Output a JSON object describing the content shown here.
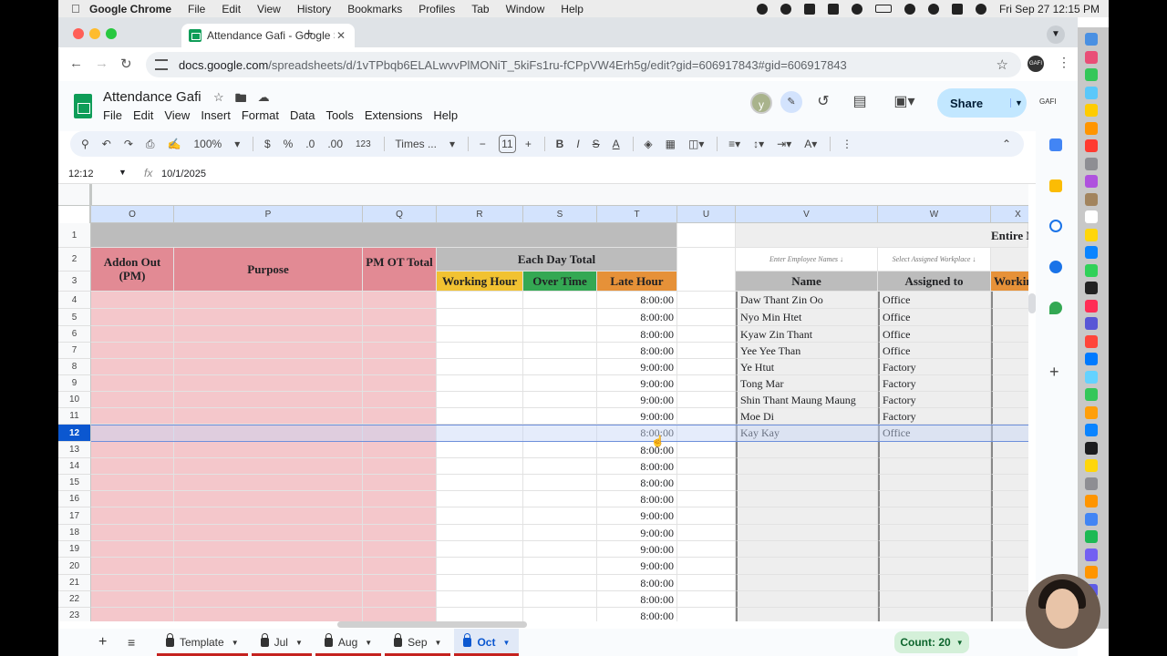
{
  "menubar": {
    "app": "Google Chrome",
    "items": [
      "File",
      "Edit",
      "View",
      "History",
      "Bookmarks",
      "Profiles",
      "Tab",
      "Window",
      "Help"
    ],
    "clock": "Fri Sep 27  12:15 PM"
  },
  "browser": {
    "tab_title": "Attendance Gafi - Google She",
    "url_host": "docs.google.com",
    "url_path": "/spreadsheets/d/1vTPbqb6ELALwvvPlMONiT_5kiFs1ru-fCPpVW4Erh5g/edit?gid=606917843#gid=606917843",
    "profile_label": "GAFI"
  },
  "doc": {
    "title": "Attendance Gafi",
    "menu": [
      "File",
      "Edit",
      "View",
      "Insert",
      "Format",
      "Data",
      "Tools",
      "Extensions",
      "Help"
    ],
    "avatar_initial": "y",
    "share_label": "Share",
    "brand": "GAFI"
  },
  "toolbar": {
    "zoom": "100%",
    "currency": "$",
    "percent": "%",
    "dec_down": ".0",
    "dec_up": ".00",
    "format_123": "123",
    "font": "Times ...",
    "font_size": "11"
  },
  "formula": {
    "namebox": "12:12",
    "fx": "fx",
    "value": "10/1/2025"
  },
  "grid": {
    "columns": [
      "O",
      "P",
      "Q",
      "R",
      "S",
      "T",
      "U",
      "V",
      "W",
      "X"
    ],
    "headers": {
      "addon_out": "Addon Out (PM)",
      "purpose": "Purpose",
      "pm_ot_total": "PM OT Total",
      "each_day_total": "Each Day Total",
      "working_hour": "Working Hour",
      "over_time": "Over Time",
      "late_hour": "Late Hour",
      "entire": "Entire M",
      "enter_names_hint": "Enter Employee Names ↓",
      "select_workplace_hint": "Select Assigned Workplace ↓",
      "name": "Name",
      "assigned_to": "Assigned to",
      "workin": "Workin"
    },
    "row_numbers": [
      "1",
      "2",
      "3",
      "4",
      "5",
      "6",
      "7",
      "8",
      "9",
      "10",
      "11",
      "12",
      "13",
      "14",
      "15",
      "16",
      "17",
      "18",
      "19",
      "20",
      "21",
      "22",
      "23"
    ],
    "selected_row": "12",
    "late_hours": [
      "8:00:00",
      "8:00:00",
      "8:00:00",
      "8:00:00",
      "9:00:00",
      "9:00:00",
      "9:00:00",
      "9:00:00",
      "8:00:00",
      "8:00:00",
      "8:00:00",
      "8:00:00",
      "8:00:00",
      "9:00:00",
      "9:00:00",
      "9:00:00",
      "9:00:00",
      "8:00:00",
      "8:00:00",
      "8:00:00"
    ],
    "employees": [
      {
        "name": "Daw Thant Zin Oo",
        "assigned": "Office"
      },
      {
        "name": "Nyo Min Htet",
        "assigned": "Office"
      },
      {
        "name": "Kyaw Zin Thant",
        "assigned": "Office"
      },
      {
        "name": "Yee Yee Than",
        "assigned": "Office"
      },
      {
        "name": "Ye Htut",
        "assigned": "Factory"
      },
      {
        "name": "Tong Mar",
        "assigned": "Factory"
      },
      {
        "name": "Shin Thant Maung Maung",
        "assigned": "Factory"
      },
      {
        "name": "Moe Di",
        "assigned": "Factory"
      },
      {
        "name": "Kay Kay",
        "assigned": "Office"
      }
    ]
  },
  "sheets": {
    "tabs": [
      "Template",
      "Jul",
      "Aug",
      "Sep",
      "Oct"
    ],
    "active": "Oct",
    "count": "Count: 20"
  },
  "colors": {
    "pink": "#f4c7cb",
    "pink_header": "#e28a94",
    "yellow": "#f1c232",
    "green": "#34a853",
    "orange": "#e69138",
    "selection": "#0b57d0",
    "share": "#c2e7ff"
  }
}
